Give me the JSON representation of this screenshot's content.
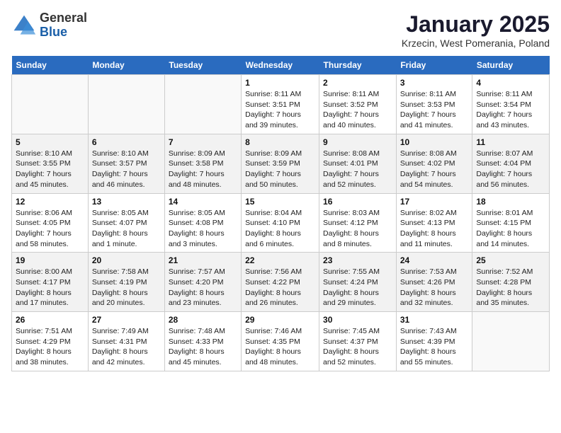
{
  "header": {
    "logo": {
      "general": "General",
      "blue": "Blue"
    },
    "title": "January 2025",
    "location": "Krzecin, West Pomerania, Poland"
  },
  "weekdays": [
    "Sunday",
    "Monday",
    "Tuesday",
    "Wednesday",
    "Thursday",
    "Friday",
    "Saturday"
  ],
  "weeks": [
    [
      {
        "day": "",
        "info": ""
      },
      {
        "day": "",
        "info": ""
      },
      {
        "day": "",
        "info": ""
      },
      {
        "day": "1",
        "info": "Sunrise: 8:11 AM\nSunset: 3:51 PM\nDaylight: 7 hours\nand 39 minutes."
      },
      {
        "day": "2",
        "info": "Sunrise: 8:11 AM\nSunset: 3:52 PM\nDaylight: 7 hours\nand 40 minutes."
      },
      {
        "day": "3",
        "info": "Sunrise: 8:11 AM\nSunset: 3:53 PM\nDaylight: 7 hours\nand 41 minutes."
      },
      {
        "day": "4",
        "info": "Sunrise: 8:11 AM\nSunset: 3:54 PM\nDaylight: 7 hours\nand 43 minutes."
      }
    ],
    [
      {
        "day": "5",
        "info": "Sunrise: 8:10 AM\nSunset: 3:55 PM\nDaylight: 7 hours\nand 45 minutes."
      },
      {
        "day": "6",
        "info": "Sunrise: 8:10 AM\nSunset: 3:57 PM\nDaylight: 7 hours\nand 46 minutes."
      },
      {
        "day": "7",
        "info": "Sunrise: 8:09 AM\nSunset: 3:58 PM\nDaylight: 7 hours\nand 48 minutes."
      },
      {
        "day": "8",
        "info": "Sunrise: 8:09 AM\nSunset: 3:59 PM\nDaylight: 7 hours\nand 50 minutes."
      },
      {
        "day": "9",
        "info": "Sunrise: 8:08 AM\nSunset: 4:01 PM\nDaylight: 7 hours\nand 52 minutes."
      },
      {
        "day": "10",
        "info": "Sunrise: 8:08 AM\nSunset: 4:02 PM\nDaylight: 7 hours\nand 54 minutes."
      },
      {
        "day": "11",
        "info": "Sunrise: 8:07 AM\nSunset: 4:04 PM\nDaylight: 7 hours\nand 56 minutes."
      }
    ],
    [
      {
        "day": "12",
        "info": "Sunrise: 8:06 AM\nSunset: 4:05 PM\nDaylight: 7 hours\nand 58 minutes."
      },
      {
        "day": "13",
        "info": "Sunrise: 8:05 AM\nSunset: 4:07 PM\nDaylight: 8 hours\nand 1 minute."
      },
      {
        "day": "14",
        "info": "Sunrise: 8:05 AM\nSunset: 4:08 PM\nDaylight: 8 hours\nand 3 minutes."
      },
      {
        "day": "15",
        "info": "Sunrise: 8:04 AM\nSunset: 4:10 PM\nDaylight: 8 hours\nand 6 minutes."
      },
      {
        "day": "16",
        "info": "Sunrise: 8:03 AM\nSunset: 4:12 PM\nDaylight: 8 hours\nand 8 minutes."
      },
      {
        "day": "17",
        "info": "Sunrise: 8:02 AM\nSunset: 4:13 PM\nDaylight: 8 hours\nand 11 minutes."
      },
      {
        "day": "18",
        "info": "Sunrise: 8:01 AM\nSunset: 4:15 PM\nDaylight: 8 hours\nand 14 minutes."
      }
    ],
    [
      {
        "day": "19",
        "info": "Sunrise: 8:00 AM\nSunset: 4:17 PM\nDaylight: 8 hours\nand 17 minutes."
      },
      {
        "day": "20",
        "info": "Sunrise: 7:58 AM\nSunset: 4:19 PM\nDaylight: 8 hours\nand 20 minutes."
      },
      {
        "day": "21",
        "info": "Sunrise: 7:57 AM\nSunset: 4:20 PM\nDaylight: 8 hours\nand 23 minutes."
      },
      {
        "day": "22",
        "info": "Sunrise: 7:56 AM\nSunset: 4:22 PM\nDaylight: 8 hours\nand 26 minutes."
      },
      {
        "day": "23",
        "info": "Sunrise: 7:55 AM\nSunset: 4:24 PM\nDaylight: 8 hours\nand 29 minutes."
      },
      {
        "day": "24",
        "info": "Sunrise: 7:53 AM\nSunset: 4:26 PM\nDaylight: 8 hours\nand 32 minutes."
      },
      {
        "day": "25",
        "info": "Sunrise: 7:52 AM\nSunset: 4:28 PM\nDaylight: 8 hours\nand 35 minutes."
      }
    ],
    [
      {
        "day": "26",
        "info": "Sunrise: 7:51 AM\nSunset: 4:29 PM\nDaylight: 8 hours\nand 38 minutes."
      },
      {
        "day": "27",
        "info": "Sunrise: 7:49 AM\nSunset: 4:31 PM\nDaylight: 8 hours\nand 42 minutes."
      },
      {
        "day": "28",
        "info": "Sunrise: 7:48 AM\nSunset: 4:33 PM\nDaylight: 8 hours\nand 45 minutes."
      },
      {
        "day": "29",
        "info": "Sunrise: 7:46 AM\nSunset: 4:35 PM\nDaylight: 8 hours\nand 48 minutes."
      },
      {
        "day": "30",
        "info": "Sunrise: 7:45 AM\nSunset: 4:37 PM\nDaylight: 8 hours\nand 52 minutes."
      },
      {
        "day": "31",
        "info": "Sunrise: 7:43 AM\nSunset: 4:39 PM\nDaylight: 8 hours\nand 55 minutes."
      },
      {
        "day": "",
        "info": ""
      }
    ]
  ]
}
